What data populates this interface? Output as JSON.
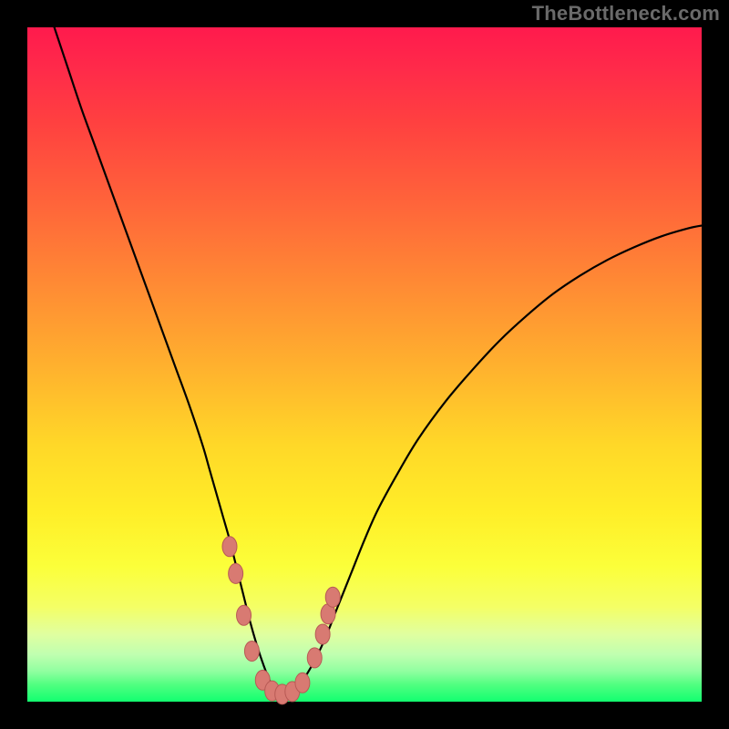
{
  "watermark": "TheBottleneck.com",
  "colors": {
    "page_bg": "#000000",
    "gradient_top": "#ff1a4d",
    "gradient_bottom": "#12ff70",
    "curve_stroke": "#000000",
    "marker_fill": "#d87a72",
    "marker_stroke": "#b85a55"
  },
  "chart_data": {
    "type": "line",
    "title": "",
    "xlabel": "",
    "ylabel": "",
    "xlim": [
      0,
      100
    ],
    "ylim": [
      0,
      100
    ],
    "grid": false,
    "legend": false,
    "curve": {
      "x": [
        4,
        6,
        8,
        10,
        12,
        14,
        16,
        18,
        20,
        22,
        24,
        26,
        27,
        28,
        29,
        30,
        31,
        32,
        33,
        34,
        35,
        36,
        37,
        38,
        39,
        40,
        42,
        44,
        46,
        48,
        50,
        52,
        55,
        58,
        62,
        66,
        70,
        74,
        78,
        82,
        86,
        90,
        94,
        98,
        100
      ],
      "y": [
        100,
        94,
        88,
        82.5,
        77,
        71.5,
        66,
        60.5,
        55,
        49.5,
        44,
        38,
        34.5,
        31,
        27.5,
        24,
        20,
        16,
        12,
        8.5,
        5.5,
        3,
        1.5,
        1,
        1.2,
        2,
        5,
        9,
        14,
        19,
        24,
        28.5,
        34,
        39,
        44.5,
        49.2,
        53.5,
        57.2,
        60.5,
        63.2,
        65.5,
        67.4,
        69,
        70.2,
        70.6
      ]
    },
    "markers": [
      {
        "x": 30.0,
        "y": 23.0
      },
      {
        "x": 30.9,
        "y": 19.0
      },
      {
        "x": 32.1,
        "y": 12.8
      },
      {
        "x": 33.3,
        "y": 7.5
      },
      {
        "x": 34.9,
        "y": 3.2
      },
      {
        "x": 36.3,
        "y": 1.6
      },
      {
        "x": 37.8,
        "y": 1.1
      },
      {
        "x": 39.3,
        "y": 1.5
      },
      {
        "x": 40.8,
        "y": 2.8
      },
      {
        "x": 42.6,
        "y": 6.5
      },
      {
        "x": 43.8,
        "y": 10.0
      },
      {
        "x": 44.6,
        "y": 13.0
      },
      {
        "x": 45.3,
        "y": 15.5
      }
    ]
  }
}
